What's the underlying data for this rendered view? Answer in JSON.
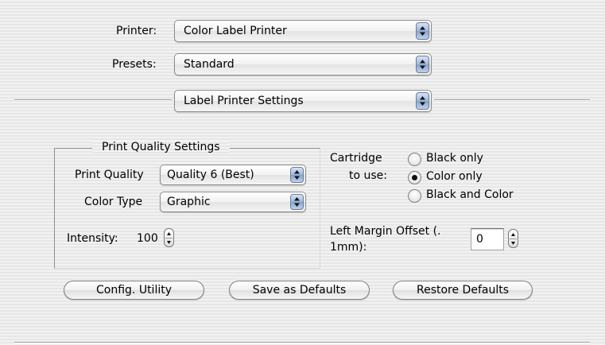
{
  "printer": {
    "label": "Printer:",
    "value": "Color Label Printer"
  },
  "presets": {
    "label": "Presets:",
    "value": "Standard"
  },
  "panel": {
    "value": "Label Printer Settings"
  },
  "quality_group": {
    "title": "Print Quality Settings",
    "print_quality_label": "Print Quality",
    "print_quality_value": "Quality 6 (Best)",
    "color_type_label": "Color Type",
    "color_type_value": "Graphic",
    "intensity_label": "Intensity:",
    "intensity_value": "100"
  },
  "cartridge": {
    "label_line1": "Cartridge",
    "label_line2": "to use:",
    "options": [
      "Black only",
      "Color only",
      "Black and Color"
    ],
    "selected": "Color only"
  },
  "margin": {
    "label_line1": "Left Margin Offset (.",
    "label_line2": "1mm):",
    "value": "0"
  },
  "buttons": {
    "config": "Config. Utility",
    "save_defaults": "Save as Defaults",
    "restore_defaults": "Restore Defaults"
  },
  "icons": {
    "popup_arrows": "up-down-arrows-icon",
    "stepper": "stepper-arrows-icon"
  }
}
